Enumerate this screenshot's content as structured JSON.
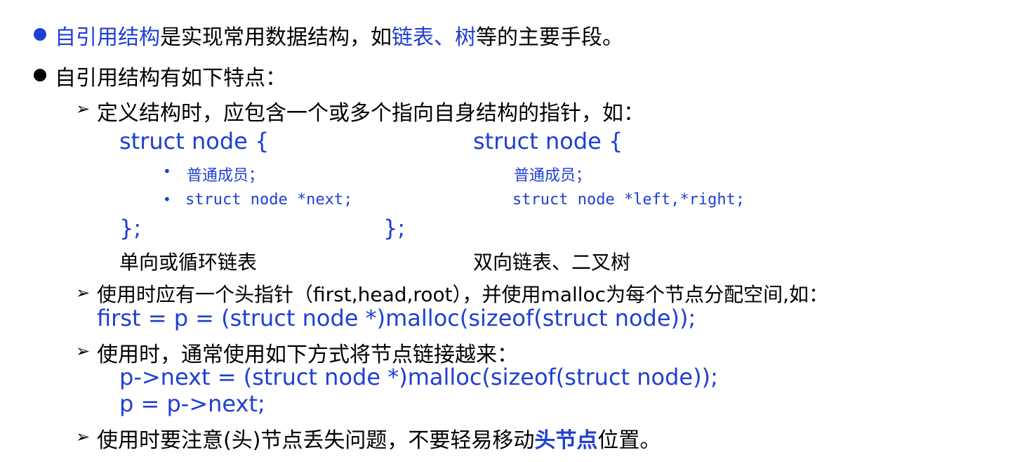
{
  "bullet1": {
    "part1": "自引用结构",
    "part2": "是实现常用数据结构，如",
    "part3": "链表、树",
    "part4": "等的主要手段。"
  },
  "bullet2": {
    "text": "自引用结构有如下特点："
  },
  "point1": {
    "text": "定义结构时，应包含一个或多个指向自身结构的指针，如："
  },
  "left_struct": {
    "header": "struct node {",
    "member1": "普通成员；",
    "member2": "struct node *next;",
    "close": "};",
    "caption": "单向或循环链表"
  },
  "right_struct": {
    "header": "struct node {",
    "member1": "普通成员；",
    "member2": "struct node *left,*right;",
    "close": "};",
    "caption": "双向链表、二叉树"
  },
  "point2": {
    "text": "使用时应有一个头指针（first,head,root），并使用malloc为每个节点分配空间,如：",
    "code": "first = p = (struct node *)malloc(sizeof(struct node));"
  },
  "point3": {
    "text": "使用时，通常使用如下方式将节点链接越来：",
    "code1": "p->next = (struct node *)malloc(sizeof(struct node));",
    "code2": "p = p->next;"
  },
  "point4": {
    "text1": "使用时要注意(头)节点丢失问题，不要轻易移动",
    "text2": "头节点",
    "text3": "位置。"
  },
  "icons": {
    "bullet": "filled-circle-icon",
    "arrow": "arrow-right-icon"
  },
  "colors": {
    "accent": "#1f3fd2",
    "text": "#000000"
  }
}
